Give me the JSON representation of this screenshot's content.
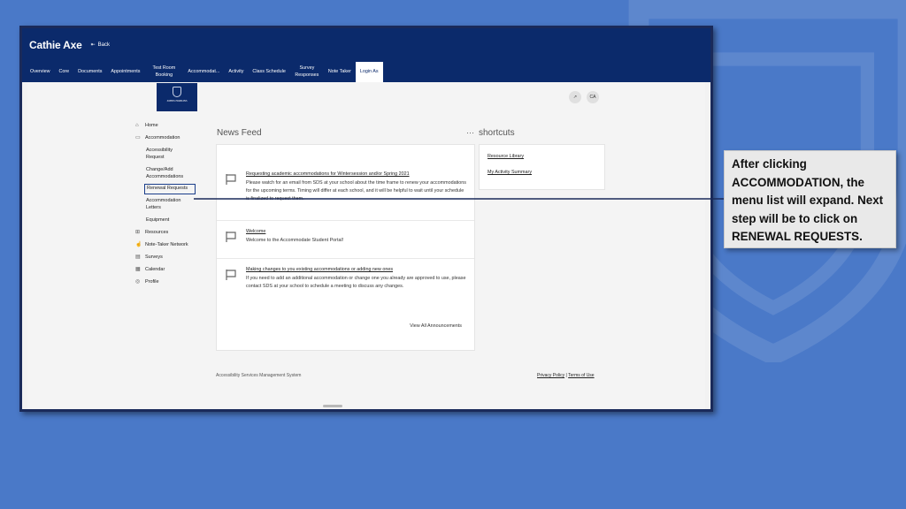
{
  "header": {
    "user_name": "Cathie Axe",
    "back_label": "Back"
  },
  "tabs": [
    {
      "label": "Overview"
    },
    {
      "label": "Core"
    },
    {
      "label": "Documents"
    },
    {
      "label": "Appointments"
    },
    {
      "label": "Test Room Booking"
    },
    {
      "label": "Accommodat..."
    },
    {
      "label": "Activity"
    },
    {
      "label": "Class Schedule"
    },
    {
      "label": "Survey Responses"
    },
    {
      "label": "Note Taker"
    },
    {
      "label": "Login As"
    }
  ],
  "logo_text": "JOHNS HOPKINS",
  "account_initials": "CA",
  "sidebar": {
    "home": "Home",
    "accommodation": "Accommodation",
    "accessibility_request": "Accessibility Request",
    "change_add": "Change/Add Accommodations",
    "renewal_requests": "Renewal Requests",
    "accommodation_letters": "Accommodation Letters",
    "equipment": "Equipment",
    "resources": "Resources",
    "note_taker_network": "Note-Taker Network",
    "surveys": "Surveys",
    "calendar": "Calendar",
    "profile": "Profile"
  },
  "news_feed": {
    "title": "News Feed",
    "menu_glyph": "···",
    "items": [
      {
        "title": "Requesting academic accommodations for Wintersession and/or Spring 2021",
        "body": "Please watch for an email from SDS at your school about the time frame to renew your accommodations for the upcoming terms. Timing will differ at each school, and it will be helpful to wait until your schedule is finalized to request them."
      },
      {
        "title": "Welcome",
        "body": "Welcome to the Accommodate Student Portal!"
      },
      {
        "title": "Making changes to you existing accommodations or adding new ones",
        "body": "If you need to add an additional accommodation or change one you already are approved to use, please contact SDS at your school to schedule a meeting to discuss any changes."
      }
    ],
    "view_all": "View All Announcements"
  },
  "shortcuts": {
    "title": "shortcuts",
    "links": [
      "Resource Library",
      "My Activity Summary"
    ]
  },
  "footer": {
    "system_name": "Accessibility Services Management System",
    "privacy": "Privacy Policy",
    "separator": "|",
    "terms": "Terms of Use"
  },
  "callout": {
    "text": "After clicking ACCOMMODATION, the menu list will expand. Next step will be to click on RENEWAL REQUESTS."
  },
  "colors": {
    "slide_bg": "#4a79c8",
    "nav_bg": "#0b2a6b",
    "highlight": "#1a3d8a"
  }
}
